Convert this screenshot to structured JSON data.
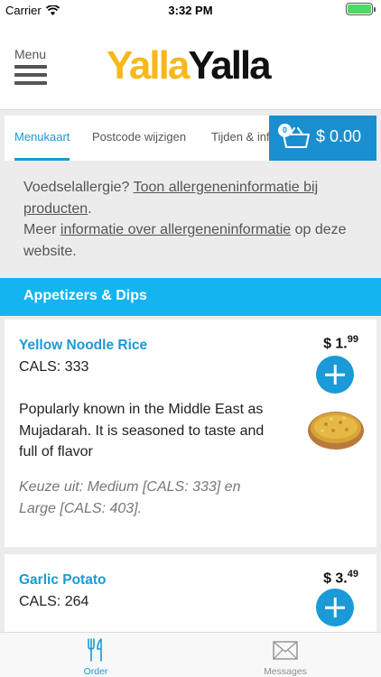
{
  "status_bar": {
    "carrier": "Carrier",
    "time": "3:32 PM"
  },
  "header": {
    "menu_label": "Menu",
    "logo_part1": "Yalla",
    "logo_part2": "Yalla"
  },
  "tabs": [
    {
      "label": "Menukaart",
      "active": true
    },
    {
      "label": "Postcode wijzigen",
      "active": false
    },
    {
      "label": "Tijden & info",
      "active": false
    }
  ],
  "cart": {
    "count": "0",
    "total": "$ 0.00"
  },
  "allergen": {
    "line1_prefix": "Voedselallergie? ",
    "line1_link": "Toon allergeneninformatie bij producten",
    "line1_suffix": ".",
    "line2_prefix": "Meer ",
    "line2_link": "informatie over allergeneninformatie",
    "line2_suffix": " op deze website."
  },
  "category": {
    "title": "Appetizers & Dips"
  },
  "items": [
    {
      "name": "Yellow Noodle Rice",
      "cals": "CALS: 333",
      "price_main": "$ 1.",
      "price_cents": "99",
      "description": "Popularly known in the Middle East as Mujadarah. It is seasoned to taste and full of flavor",
      "choice": "Keuze uit: Medium [CALS: 333] en Large [CALS: 403]."
    },
    {
      "name": "Garlic Potato",
      "cals": "CALS: 264",
      "price_main": "$ 3.",
      "price_cents": "49"
    }
  ],
  "bottom_nav": [
    {
      "label": "Order",
      "icon": "fork-knife-icon",
      "active": true
    },
    {
      "label": "Messages",
      "icon": "envelope-icon",
      "active": false
    }
  ],
  "colors": {
    "accent": "#1a9ad6",
    "category": "#14b4f0",
    "logo_yellow": "#f6b81b"
  }
}
